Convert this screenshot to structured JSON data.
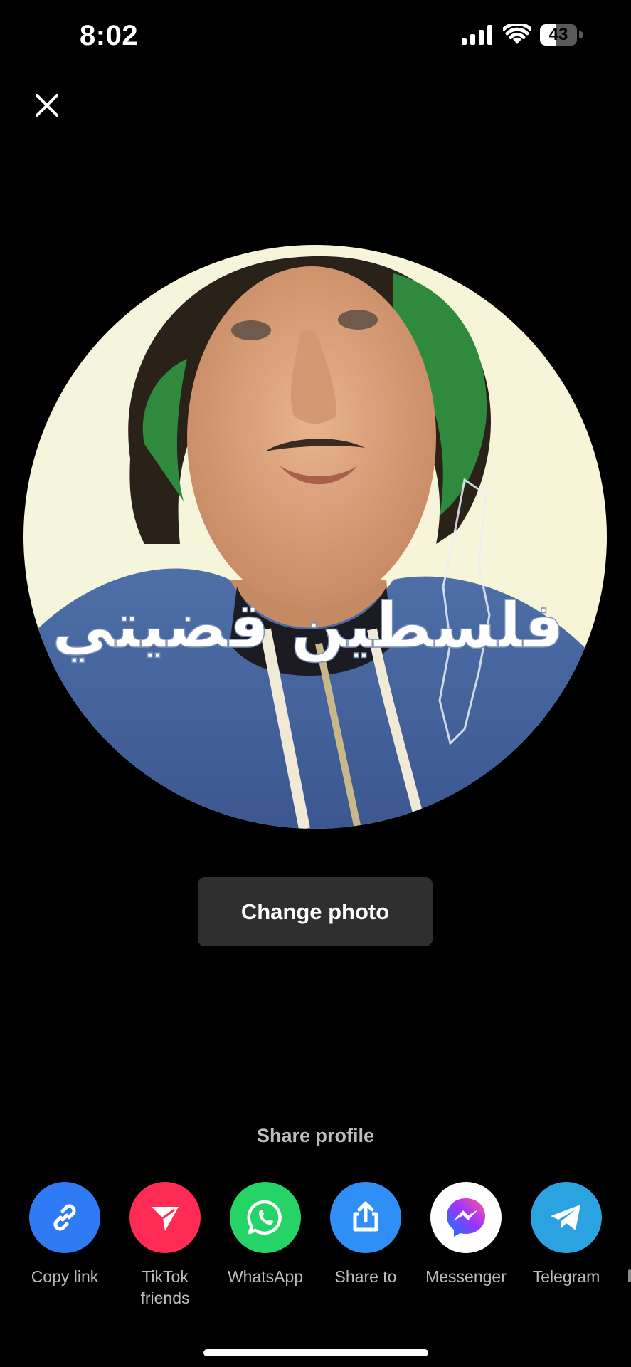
{
  "status_bar": {
    "time": "8:02",
    "battery_level": "43",
    "battery_fraction": 0.43
  },
  "header": {
    "close_icon": "close-icon"
  },
  "profile": {
    "photo_overlay_text": "فلسطين قضيتي",
    "change_photo_label": "Change photo"
  },
  "share": {
    "title": "Share profile",
    "items": [
      {
        "label": "Copy link",
        "icon": "link-icon",
        "color": "#2f7bf5"
      },
      {
        "label": "TikTok friends",
        "icon": "paper-plane-icon",
        "color": "#fe2c55"
      },
      {
        "label": "WhatsApp",
        "icon": "whatsapp-icon",
        "color": "#25d366"
      },
      {
        "label": "Share to",
        "icon": "share-upload-icon",
        "color": "#2f8ff7"
      },
      {
        "label": "Messenger",
        "icon": "messenger-icon",
        "color": "#ffffff"
      },
      {
        "label": "Telegram",
        "icon": "telegram-icon",
        "color": "#2aa3e0"
      }
    ]
  }
}
